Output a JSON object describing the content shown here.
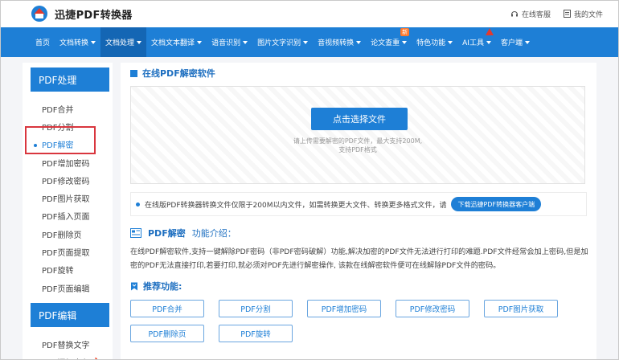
{
  "header": {
    "brand": "迅捷PDF转换器",
    "service_label": "在线客服",
    "files_label": "我的文件"
  },
  "nav": {
    "items": [
      {
        "label": "首页",
        "caret": false
      },
      {
        "label": "文档转换",
        "caret": true
      },
      {
        "label": "文档处理",
        "caret": true,
        "active": true
      },
      {
        "label": "文档文本翻译",
        "caret": true
      },
      {
        "label": "语音识别",
        "caret": true
      },
      {
        "label": "图片文字识别",
        "caret": true
      },
      {
        "label": "音视频转换",
        "caret": true
      },
      {
        "label": "论文查重",
        "caret": true,
        "badge": "新"
      },
      {
        "label": "特色功能",
        "caret": true
      },
      {
        "label": "AI工具",
        "caret": true,
        "arrow": true
      },
      {
        "label": "客户端",
        "caret": true
      }
    ]
  },
  "sidebar": {
    "group1_title": "PDF处理",
    "group1_items": [
      "PDF合并",
      "PDF分割",
      "PDF解密",
      "PDF增加密码",
      "PDF修改密码",
      "PDF图片获取",
      "PDF插入页面",
      "PDF删除页",
      "PDF页面提取",
      "PDF旋转",
      "PDF页面编辑"
    ],
    "active_item": "PDF解密",
    "group2_title": "PDF编辑",
    "group2_items": [
      "PDF替换文字",
      "PDF添加水印"
    ]
  },
  "main": {
    "section_title": "在线PDF解密软件",
    "upload_button": "点击选择文件",
    "upload_hint_line1": "请上传需要解密的PDF文件，最大支持200M,",
    "upload_hint_line2": "支持PDF格式",
    "notice_text": "在线版PDF转换器转换文件仅限于200M以内文件，如需转换更大文件、转换更多格式文件，请",
    "notice_button": "下载迅捷PDF转换器客户端",
    "intro_title_strong": "PDF解密",
    "intro_title_rest": "功能介绍：",
    "intro_body": "在线PDF解密软件,支持一键解除PDF密码（非PDF密码破解）功能,解决加密的PDF文件无法进行打印的难题.PDF文件经常会加上密码,但是加密的PDF无法直接打印,若要打印,就必须对PDF先进行解密操作, 该款在线解密软件便可在线解除PDF文件的密码。",
    "recommend_title": "推荐功能:",
    "recommend_items": [
      "PDF合并",
      "PDF分割",
      "PDF增加密码",
      "PDF修改密码",
      "PDF图片获取",
      "PDF删除页",
      "PDF旋转"
    ]
  },
  "colors": {
    "primary": "#1e7fd6",
    "nav_active": "#1466b4",
    "highlight_box": "#d9363e"
  }
}
